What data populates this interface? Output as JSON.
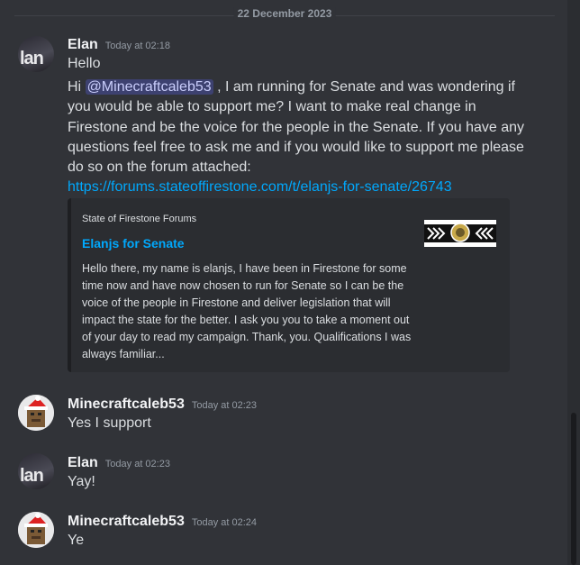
{
  "divider": {
    "date": "22 December 2023"
  },
  "messages": [
    {
      "author": "Elan",
      "time": "Today at 02:18",
      "lines": [
        "Hello"
      ],
      "mention_prefix": "Hi",
      "mention": "@Minecraftcaleb53",
      "after_mention": " , I am running for Senate and was wondering if",
      "body_lines": [
        "you would be able to support me? I want to make real change in",
        "Firestone and be the voice for the people in the Senate. If you have any",
        "questions feel free to ask me and if you would like to support me please",
        "do so on the forum attached:"
      ],
      "link": "https://forums.stateoffirestone.com/t/elanjs-for-senate/26743",
      "avatar_text": "lan",
      "embed": {
        "provider": "State of Firestone Forums",
        "title": "Elanjs for Senate",
        "description": "Hello there, my name is elanjs, I have been in Firestone for some time now and have now chosen to run for Senate so I can be the voice of the people in Firestone and deliver legislation that will impact the state for the better. I ask you you to take a moment out of your day to read my campaign. Thank, you. Qualifications I was always familiar..."
      }
    },
    {
      "author": "Minecraftcaleb53",
      "time": "Today at 02:23",
      "text": "Yes I support"
    },
    {
      "author": "Elan",
      "time": "Today at 02:23",
      "text": "Yay!",
      "avatar_text": "lan"
    },
    {
      "author": "Minecraftcaleb53",
      "time": "Today at 02:24",
      "text": "Ye"
    }
  ],
  "colors": {
    "background": "#313338",
    "link": "#00a8fc",
    "mention_bg": "#3c4270"
  }
}
